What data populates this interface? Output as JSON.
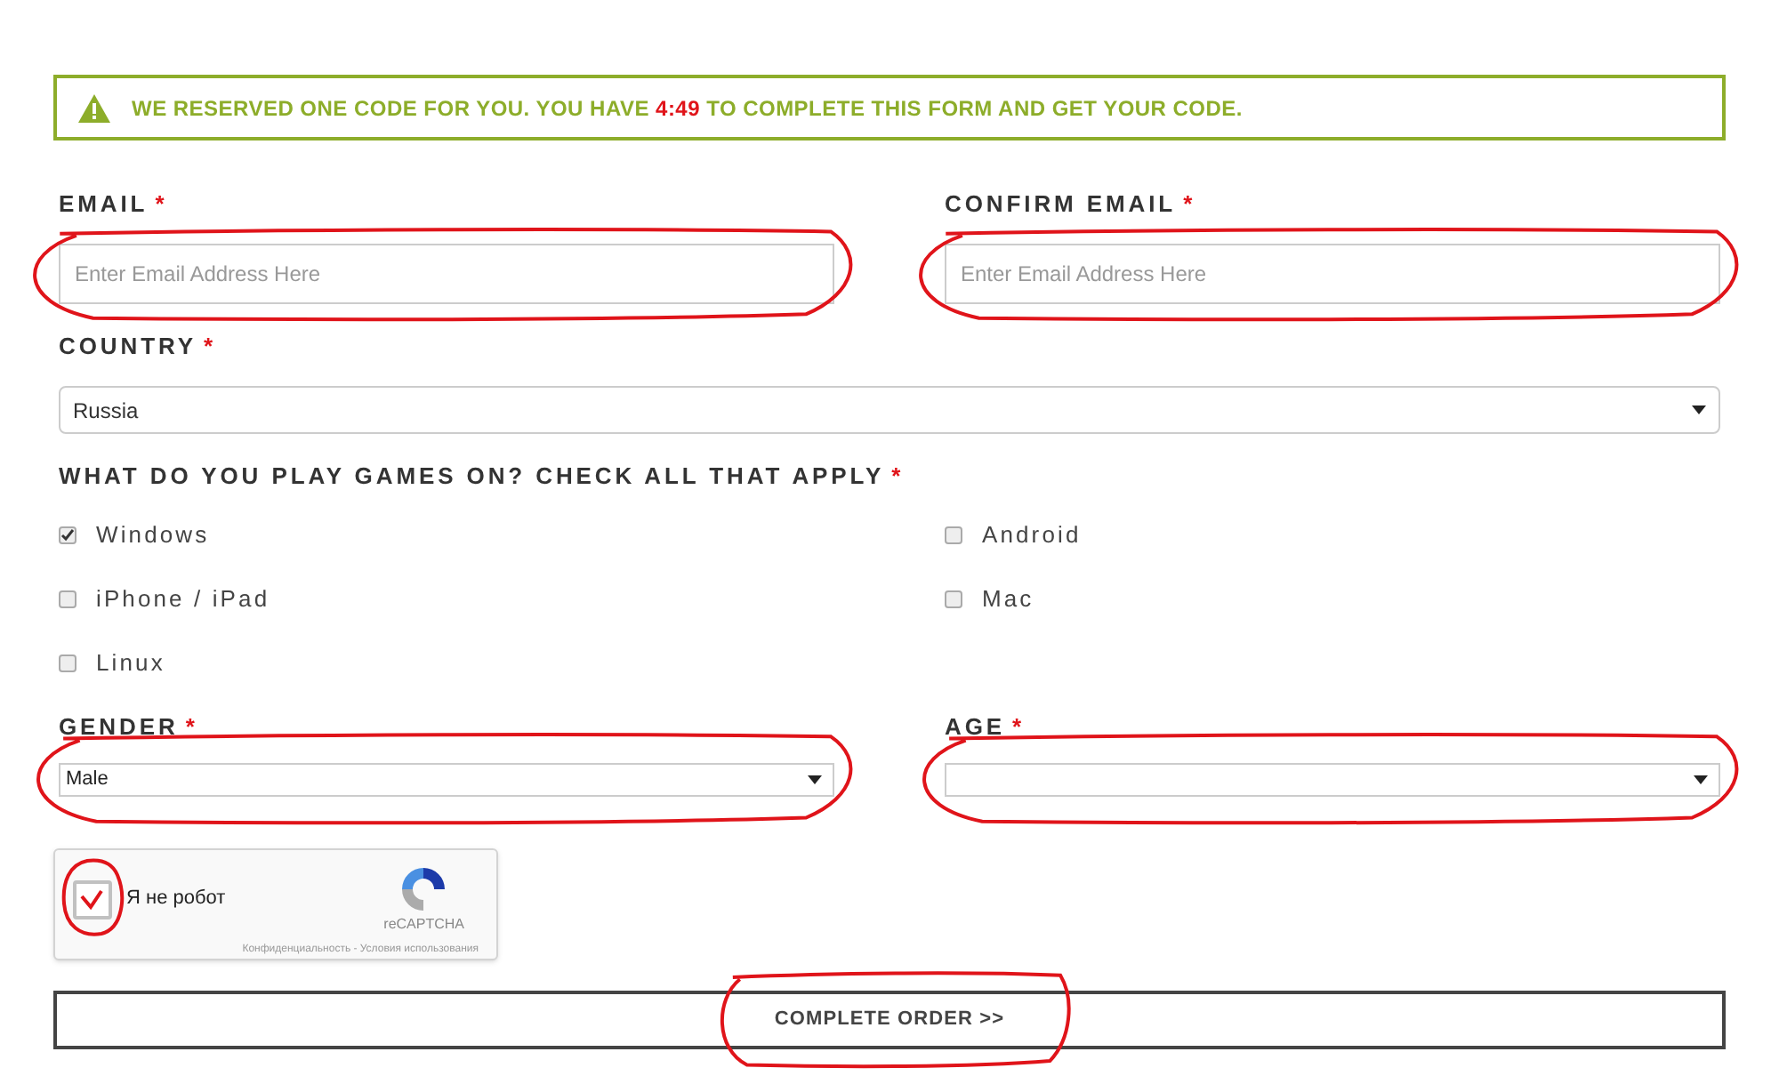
{
  "banner": {
    "before": "WE RESERVED ONE CODE FOR YOU. YOU HAVE",
    "timer": "4:49",
    "after": "TO COMPLETE THIS FORM AND GET YOUR CODE."
  },
  "email": {
    "label": "EMAIL",
    "required": "*",
    "placeholder": "Enter Email Address Here",
    "circled": true
  },
  "confirm_email": {
    "label": "CONFIRM EMAIL",
    "required": "*",
    "placeholder": "Enter Email Address Here",
    "circled": true
  },
  "country": {
    "label": "COUNTRY",
    "required": "*",
    "value": "Russia"
  },
  "platforms": {
    "label": "WHAT DO YOU PLAY GAMES ON? CHECK ALL THAT APPLY",
    "required": "*",
    "options": [
      {
        "label": "Windows",
        "checked": true
      },
      {
        "label": "Android",
        "checked": false
      },
      {
        "label": "iPhone / iPad",
        "checked": false
      },
      {
        "label": "Mac",
        "checked": false
      },
      {
        "label": "Linux",
        "checked": false
      }
    ]
  },
  "gender": {
    "label": "GENDER",
    "required": "*",
    "value": "Male",
    "circled": true
  },
  "age": {
    "label": "AGE",
    "required": "*",
    "circled": true
  },
  "captcha": {
    "label": "Я не робот",
    "checked": true,
    "scribbled": true,
    "brand": "reCAPTCHA",
    "links": "Конфиденциальность - Условия использования"
  },
  "submit": {
    "label": "COMPLETE ORDER >>",
    "circled": true
  }
}
